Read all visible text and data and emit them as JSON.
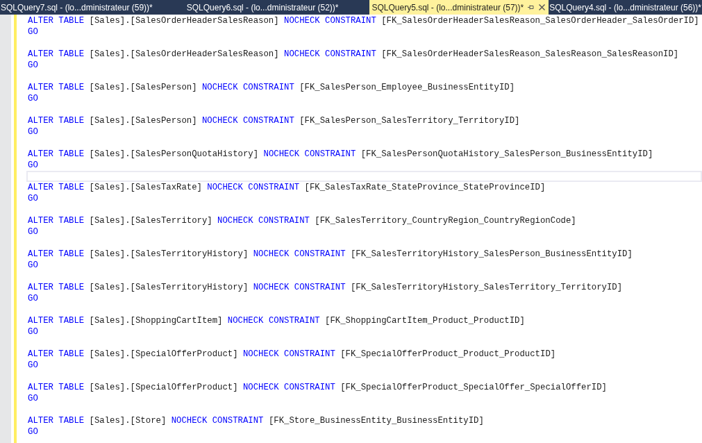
{
  "tabs": [
    {
      "label": "SQLQuery7.sql - (lo...dministrateur (59))*",
      "selected": false
    },
    {
      "label": "SQLQuery6.sql - (lo...dministrateur (52))*",
      "selected": false
    },
    {
      "label": "SQLQuery5.sql - (lo...dministrateur (57))*",
      "selected": true
    },
    {
      "label": "SQLQuery4.sql - (lo...dministrateur (56))*",
      "selected": false
    }
  ],
  "editor": {
    "lines": [
      {
        "kind": "code",
        "tokens": [
          {
            "text": "ALTER TABLE",
            "kind": "keyword"
          },
          {
            "text": "[Sales].[SalesOrderHeaderSalesReason]",
            "kind": "identifier"
          },
          {
            "text": "NOCHECK CONSTRAINT",
            "kind": "keyword"
          },
          {
            "text": "[FK_SalesOrderHeaderSalesReason_SalesOrderHeader_SalesOrderID]",
            "kind": "identifier"
          }
        ]
      },
      {
        "kind": "code",
        "tokens": [
          {
            "text": "GO",
            "kind": "keyword"
          }
        ]
      },
      {
        "kind": "blank"
      },
      {
        "kind": "code",
        "tokens": [
          {
            "text": "ALTER TABLE",
            "kind": "keyword"
          },
          {
            "text": "[Sales].[SalesOrderHeaderSalesReason]",
            "kind": "identifier"
          },
          {
            "text": "NOCHECK CONSTRAINT",
            "kind": "keyword"
          },
          {
            "text": "[FK_SalesOrderHeaderSalesReason_SalesReason_SalesReasonID]",
            "kind": "identifier"
          }
        ]
      },
      {
        "kind": "code",
        "tokens": [
          {
            "text": "GO",
            "kind": "keyword"
          }
        ]
      },
      {
        "kind": "blank"
      },
      {
        "kind": "code",
        "tokens": [
          {
            "text": "ALTER TABLE",
            "kind": "keyword"
          },
          {
            "text": "[Sales].[SalesPerson]",
            "kind": "identifier"
          },
          {
            "text": "NOCHECK CONSTRAINT",
            "kind": "keyword"
          },
          {
            "text": "[FK_SalesPerson_Employee_BusinessEntityID]",
            "kind": "identifier"
          }
        ]
      },
      {
        "kind": "code",
        "tokens": [
          {
            "text": "GO",
            "kind": "keyword"
          }
        ]
      },
      {
        "kind": "blank"
      },
      {
        "kind": "code",
        "tokens": [
          {
            "text": "ALTER TABLE",
            "kind": "keyword"
          },
          {
            "text": "[Sales].[SalesPerson]",
            "kind": "identifier"
          },
          {
            "text": "NOCHECK CONSTRAINT",
            "kind": "keyword"
          },
          {
            "text": "[FK_SalesPerson_SalesTerritory_TerritoryID]",
            "kind": "identifier"
          }
        ]
      },
      {
        "kind": "code",
        "tokens": [
          {
            "text": "GO",
            "kind": "keyword"
          }
        ]
      },
      {
        "kind": "blank"
      },
      {
        "kind": "code",
        "tokens": [
          {
            "text": "ALTER TABLE",
            "kind": "keyword"
          },
          {
            "text": "[Sales].[SalesPersonQuotaHistory]",
            "kind": "identifier"
          },
          {
            "text": "NOCHECK CONSTRAINT",
            "kind": "keyword"
          },
          {
            "text": "[FK_SalesPersonQuotaHistory_SalesPerson_BusinessEntityID]",
            "kind": "identifier"
          }
        ]
      },
      {
        "kind": "code",
        "tokens": [
          {
            "text": "GO",
            "kind": "keyword"
          }
        ]
      },
      {
        "kind": "current"
      },
      {
        "kind": "code",
        "tokens": [
          {
            "text": "ALTER TABLE",
            "kind": "keyword"
          },
          {
            "text": "[Sales].[SalesTaxRate]",
            "kind": "identifier"
          },
          {
            "text": "NOCHECK CONSTRAINT",
            "kind": "keyword"
          },
          {
            "text": "[FK_SalesTaxRate_StateProvince_StateProvinceID]",
            "kind": "identifier"
          }
        ]
      },
      {
        "kind": "code",
        "tokens": [
          {
            "text": "GO",
            "kind": "keyword"
          }
        ]
      },
      {
        "kind": "blank"
      },
      {
        "kind": "code",
        "tokens": [
          {
            "text": "ALTER TABLE",
            "kind": "keyword"
          },
          {
            "text": "[Sales].[SalesTerritory]",
            "kind": "identifier"
          },
          {
            "text": "NOCHECK CONSTRAINT",
            "kind": "keyword"
          },
          {
            "text": "[FK_SalesTerritory_CountryRegion_CountryRegionCode]",
            "kind": "identifier"
          }
        ]
      },
      {
        "kind": "code",
        "tokens": [
          {
            "text": "GO",
            "kind": "keyword"
          }
        ]
      },
      {
        "kind": "blank"
      },
      {
        "kind": "code",
        "tokens": [
          {
            "text": "ALTER TABLE",
            "kind": "keyword"
          },
          {
            "text": "[Sales].[SalesTerritoryHistory]",
            "kind": "identifier"
          },
          {
            "text": "NOCHECK CONSTRAINT",
            "kind": "keyword"
          },
          {
            "text": "[FK_SalesTerritoryHistory_SalesPerson_BusinessEntityID]",
            "kind": "identifier"
          }
        ]
      },
      {
        "kind": "code",
        "tokens": [
          {
            "text": "GO",
            "kind": "keyword"
          }
        ]
      },
      {
        "kind": "blank"
      },
      {
        "kind": "code",
        "tokens": [
          {
            "text": "ALTER TABLE",
            "kind": "keyword"
          },
          {
            "text": "[Sales].[SalesTerritoryHistory]",
            "kind": "identifier"
          },
          {
            "text": "NOCHECK CONSTRAINT",
            "kind": "keyword"
          },
          {
            "text": "[FK_SalesTerritoryHistory_SalesTerritory_TerritoryID]",
            "kind": "identifier"
          }
        ]
      },
      {
        "kind": "code",
        "tokens": [
          {
            "text": "GO",
            "kind": "keyword"
          }
        ]
      },
      {
        "kind": "blank"
      },
      {
        "kind": "code",
        "tokens": [
          {
            "text": "ALTER TABLE",
            "kind": "keyword"
          },
          {
            "text": "[Sales].[ShoppingCartItem]",
            "kind": "identifier"
          },
          {
            "text": "NOCHECK CONSTRAINT",
            "kind": "keyword"
          },
          {
            "text": "[FK_ShoppingCartItem_Product_ProductID]",
            "kind": "identifier"
          }
        ]
      },
      {
        "kind": "code",
        "tokens": [
          {
            "text": "GO",
            "kind": "keyword"
          }
        ]
      },
      {
        "kind": "blank"
      },
      {
        "kind": "code",
        "tokens": [
          {
            "text": "ALTER TABLE",
            "kind": "keyword"
          },
          {
            "text": "[Sales].[SpecialOfferProduct]",
            "kind": "identifier"
          },
          {
            "text": "NOCHECK CONSTRAINT",
            "kind": "keyword"
          },
          {
            "text": "[FK_SpecialOfferProduct_Product_ProductID]",
            "kind": "identifier"
          }
        ]
      },
      {
        "kind": "code",
        "tokens": [
          {
            "text": "GO",
            "kind": "keyword"
          }
        ]
      },
      {
        "kind": "blank"
      },
      {
        "kind": "code",
        "tokens": [
          {
            "text": "ALTER TABLE",
            "kind": "keyword"
          },
          {
            "text": "[Sales].[SpecialOfferProduct]",
            "kind": "identifier"
          },
          {
            "text": "NOCHECK CONSTRAINT",
            "kind": "keyword"
          },
          {
            "text": "[FK_SpecialOfferProduct_SpecialOffer_SpecialOfferID]",
            "kind": "identifier"
          }
        ]
      },
      {
        "kind": "code",
        "tokens": [
          {
            "text": "GO",
            "kind": "keyword"
          }
        ]
      },
      {
        "kind": "blank"
      },
      {
        "kind": "code",
        "tokens": [
          {
            "text": "ALTER TABLE",
            "kind": "keyword"
          },
          {
            "text": "[Sales].[Store]",
            "kind": "identifier"
          },
          {
            "text": "NOCHECK CONSTRAINT",
            "kind": "keyword"
          },
          {
            "text": "[FK_Store_BusinessEntity_BusinessEntityID]",
            "kind": "identifier"
          }
        ]
      },
      {
        "kind": "code",
        "tokens": [
          {
            "text": "GO",
            "kind": "keyword"
          }
        ]
      }
    ]
  }
}
